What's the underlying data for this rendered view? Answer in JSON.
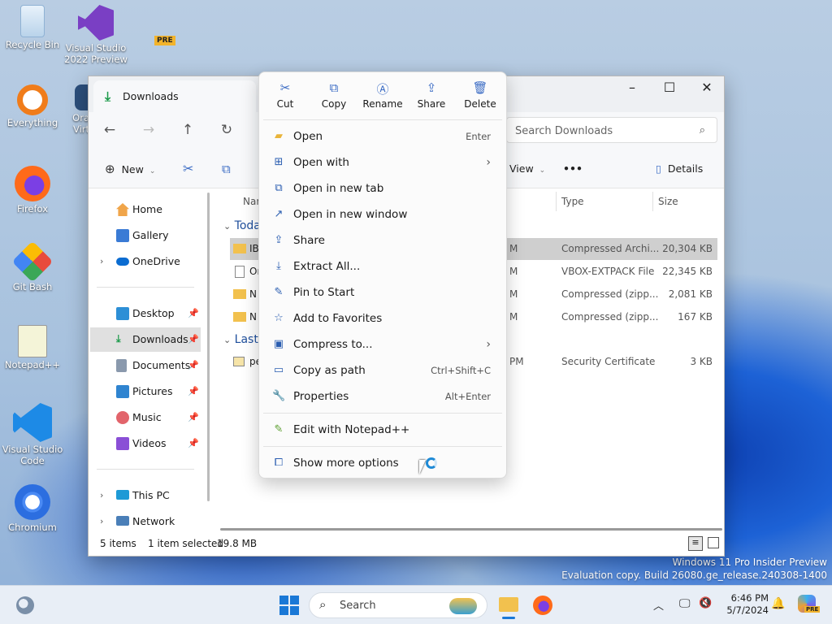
{
  "desktop": {
    "icons": [
      {
        "label": "Recycle Bin",
        "icon": "recycle-bin-icon"
      },
      {
        "label": "Visual Studio 2022 Preview",
        "icon": "visual-studio-icon",
        "badge": "PRE"
      },
      {
        "label": "Everything",
        "icon": "everything-icon"
      },
      {
        "label": "Ora Virt",
        "icon": "virtualbox-icon"
      },
      {
        "label": "Firefox",
        "icon": "firefox-icon"
      },
      {
        "label": "Git Bash",
        "icon": "git-bash-icon"
      },
      {
        "label": "Notepad++",
        "icon": "notepadpp-icon"
      },
      {
        "label": "Visual Studio Code",
        "icon": "vscode-icon"
      },
      {
        "label": "Chromium",
        "icon": "chromium-icon"
      }
    ],
    "watermark_line1": "Windows 11 Pro Insider Preview",
    "watermark_line2": "Evaluation copy. Build 26080.ge_release.240308-1400"
  },
  "explorer": {
    "tab_title": "Downloads",
    "search_placeholder": "Search Downloads",
    "toolbar": {
      "new_label": "New",
      "view_label": "View",
      "more_label": "•••",
      "details_label": "Details"
    },
    "sidebar": {
      "home": "Home",
      "gallery": "Gallery",
      "onedrive": "OneDrive",
      "desktop": "Desktop",
      "downloads": "Downloads",
      "documents": "Documents",
      "pictures": "Pictures",
      "music": "Music",
      "videos": "Videos",
      "thispc": "This PC",
      "network": "Network"
    },
    "columns": {
      "name": "Nar",
      "type": "Type",
      "size": "Size"
    },
    "groups": {
      "today": "Toda",
      "last": "Last"
    },
    "rows": [
      {
        "name": "IB",
        "date": "M",
        "type": "Compressed Archi...",
        "size": "20,304 KB"
      },
      {
        "name": "Or",
        "date": "M",
        "type": "VBOX-EXTPACK File",
        "size": "22,345 KB"
      },
      {
        "name": "N",
        "date": "M",
        "type": "Compressed (zipp...",
        "size": "2,081 KB"
      },
      {
        "name": "N",
        "date": "M",
        "type": "Compressed (zipp...",
        "size": "167 KB"
      },
      {
        "name": "pe",
        "date": "PM",
        "type": "Security Certificate",
        "size": "3 KB"
      }
    ],
    "status": {
      "items": "5 items",
      "selected": "1 item selected",
      "size": "19.8 MB"
    }
  },
  "context_menu": {
    "quick_actions": [
      {
        "label": "Cut",
        "icon": "cut-icon"
      },
      {
        "label": "Copy",
        "icon": "copy-icon"
      },
      {
        "label": "Rename",
        "icon": "rename-icon"
      },
      {
        "label": "Share",
        "icon": "share-icon"
      },
      {
        "label": "Delete",
        "icon": "delete-icon"
      }
    ],
    "items": [
      {
        "label": "Open",
        "shortcut": "Enter"
      },
      {
        "label": "Open with",
        "shortcut": ""
      },
      {
        "label": "Open in new tab",
        "shortcut": ""
      },
      {
        "label": "Open in new window",
        "shortcut": ""
      },
      {
        "label": "Share",
        "shortcut": ""
      },
      {
        "label": "Extract All...",
        "shortcut": ""
      },
      {
        "label": "Pin to Start",
        "shortcut": ""
      },
      {
        "label": "Add to Favorites",
        "shortcut": ""
      },
      {
        "label": "Compress to...",
        "shortcut": ""
      },
      {
        "label": "Copy as path",
        "shortcut": "Ctrl+Shift+C"
      },
      {
        "label": "Properties",
        "shortcut": "Alt+Enter"
      },
      {
        "label": "Edit with Notepad++",
        "shortcut": ""
      },
      {
        "label": "Show more options",
        "shortcut": ""
      }
    ]
  },
  "taskbar": {
    "search_label": "Search",
    "time": "6:46 PM",
    "date": "5/7/2024",
    "tray_badge": "PRE"
  }
}
